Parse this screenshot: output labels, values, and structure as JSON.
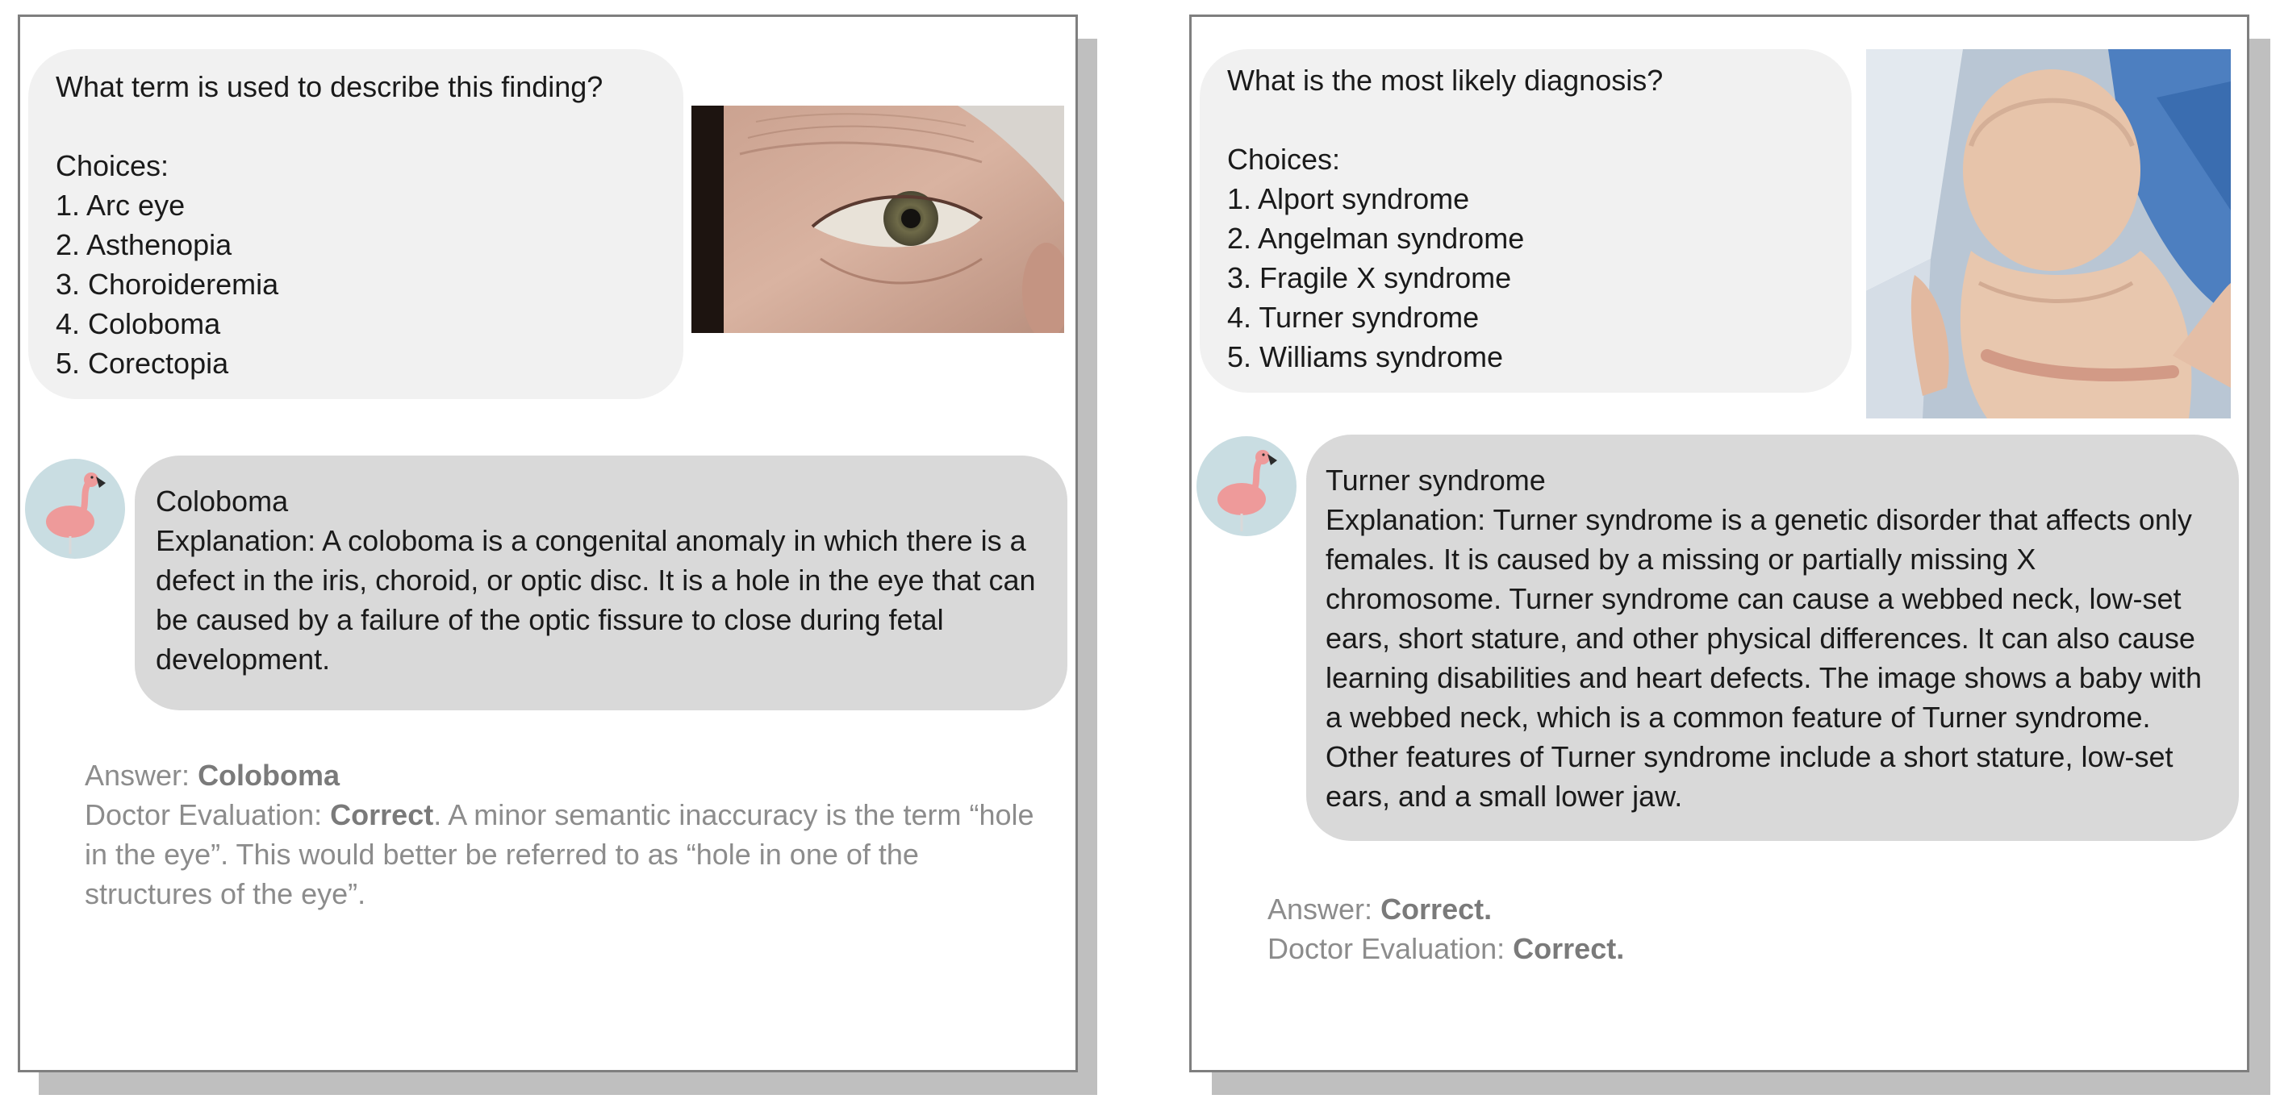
{
  "panels": [
    {
      "question": "What term is used to describe this finding?",
      "choices_label": "Choices:",
      "choices": [
        "1. Arc eye",
        "2. Asthenopia",
        "3. Choroideremia",
        "4. Coloboma",
        "5. Corectopia"
      ],
      "answer_title": "Coloboma",
      "explanation": "Explanation: A coloboma is a congenital anomaly in which there is a defect in the iris, choroid, or optic disc. It is a hole in the eye that can be caused by a failure of the optic fissure to close during fetal development.",
      "answer_label": "Answer:",
      "answer_value": "Coloboma",
      "doctor_label": "Doctor Evaluation:",
      "doctor_value": "Correct",
      "doctor_note": ". A minor semantic inaccuracy is the term “hole in the eye”. This would better be referred to as “hole in one of the structures of the eye”."
    },
    {
      "question": "What is the most likely diagnosis?",
      "choices_label": "Choices:",
      "choices": [
        "1. Alport syndrome",
        "2. Angelman syndrome",
        "3. Fragile X syndrome",
        "4. Turner syndrome",
        "5. Williams syndrome"
      ],
      "answer_title": "Turner syndrome",
      "explanation": "Explanation: Turner syndrome is a genetic disorder that affects only females. It is caused by a missing or partially missing X chromosome. Turner syndrome can cause a webbed neck, low-set ears, short stature, and other physical differences. It can also cause learning disabilities and heart defects. The image shows a baby with a webbed neck, which is a common feature of Turner syndrome. Other features of Turner syndrome include a short stature, low-set ears, and a small lower jaw.",
      "answer_label": "Answer:",
      "answer_value": "Correct.",
      "doctor_label": "Doctor Evaluation:",
      "doctor_value": "Correct."
    }
  ],
  "colors": {
    "panel_border": "#7f7f7f",
    "shadow": "#bfbfbf",
    "question_bubble": "#f1f1f1",
    "answer_bubble": "#d9d9d9",
    "avatar_bg": "#c9dde2",
    "flamingo": "#ee9a9a",
    "eval_text": "#8c8c8c"
  },
  "icons": {
    "avatar": "flamingo-icon"
  }
}
